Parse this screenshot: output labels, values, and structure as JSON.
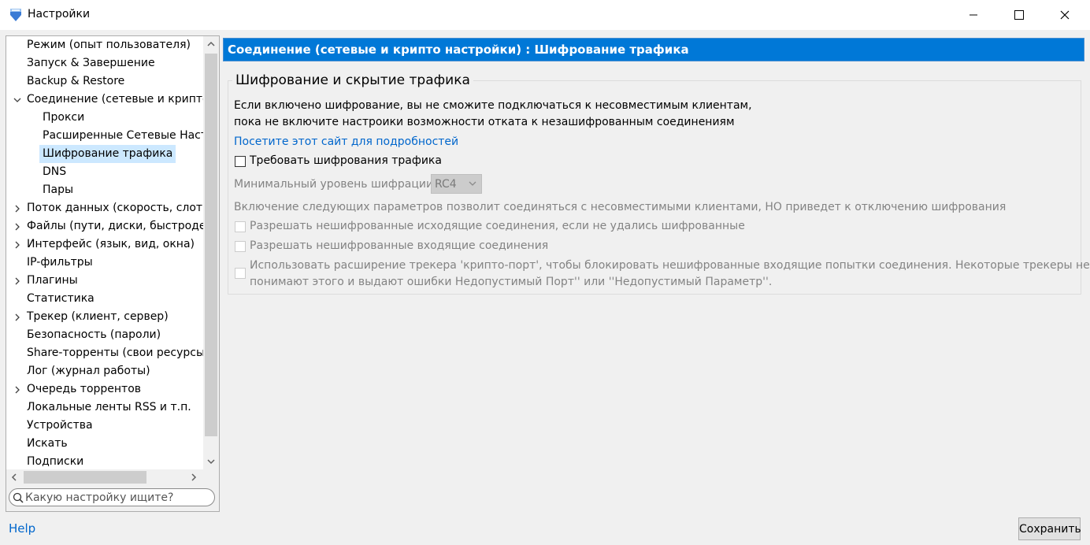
{
  "window": {
    "title": "Настройки"
  },
  "tree": {
    "items": [
      {
        "label": "Режим (опыт пользователя)",
        "level": 0,
        "expander": "none"
      },
      {
        "label": "Запуск & Завершение",
        "level": 0,
        "expander": "none"
      },
      {
        "label": "Backup & Restore",
        "level": 0,
        "expander": "none"
      },
      {
        "label": "Соединение (сетевые и крипто н",
        "level": 0,
        "expander": "expanded"
      },
      {
        "label": "Прокси",
        "level": 1,
        "expander": "none"
      },
      {
        "label": "Расширенные Сетевые Настр",
        "level": 1,
        "expander": "none"
      },
      {
        "label": "Шифрование трафика",
        "level": 1,
        "expander": "none",
        "selected": true
      },
      {
        "label": "DNS",
        "level": 1,
        "expander": "none"
      },
      {
        "label": "Пары",
        "level": 1,
        "expander": "none"
      },
      {
        "label": "Поток данных (скорость, слоты)",
        "level": 0,
        "expander": "collapsed"
      },
      {
        "label": "Файлы (пути, диски, быстродейс",
        "level": 0,
        "expander": "collapsed"
      },
      {
        "label": "Интерфейс (язык, вид, окна)",
        "level": 0,
        "expander": "collapsed"
      },
      {
        "label": "IP-фильтры",
        "level": 0,
        "expander": "none"
      },
      {
        "label": "Плагины",
        "level": 0,
        "expander": "collapsed"
      },
      {
        "label": "Статистика",
        "level": 0,
        "expander": "none"
      },
      {
        "label": "Трекер (клиент, сервер)",
        "level": 0,
        "expander": "collapsed"
      },
      {
        "label": "Безопасность (пароли)",
        "level": 0,
        "expander": "none"
      },
      {
        "label": "Share-торренты (свои ресурсы)",
        "level": 0,
        "expander": "none"
      },
      {
        "label": "Лог (журнал работы)",
        "level": 0,
        "expander": "none"
      },
      {
        "label": "Очередь торрентов",
        "level": 0,
        "expander": "collapsed"
      },
      {
        "label": "Локальные ленты RSS и т.п.",
        "level": 0,
        "expander": "none"
      },
      {
        "label": "Устройства",
        "level": 0,
        "expander": "none"
      },
      {
        "label": "Искать",
        "level": 0,
        "expander": "none"
      },
      {
        "label": "Подписки",
        "level": 0,
        "expander": "none"
      }
    ]
  },
  "search": {
    "placeholder": "Какую настройку ищите?"
  },
  "content": {
    "header": "Соединение (сетевые и крипто настройки) : Шифрование трафика",
    "group_title": "Шифрование и скрытие трафика",
    "desc_line1": "Если включено шифрование, вы не сможите подключаться к несовместимым клиентам,",
    "desc_line2": "пока не включите настроики возможности отката к незашифрованным соединениям",
    "link": "Посетите этот сайт для подробностей",
    "require_encryption": {
      "label": "Требовать шифрования трафика",
      "checked": false
    },
    "min_level_label": "Минимальный уровень шифрации",
    "min_level_value": "RC4",
    "fallback_note": "Включение следующих параметров позволит соединяться с несовместимыми клиентами, НО приведет к отключению шифрования",
    "allow_outgoing": {
      "label": "Разрешать нешифрованные исходящие соединения, если не удались шифрованные",
      "checked": false
    },
    "allow_incoming": {
      "label": "Разрешать нешифрованные входящие соединения",
      "checked": false
    },
    "crypto_port_line1": "Использовать расширение трекера 'крипто-порт', чтобы блокировать нешифрованные  входящие попытки соединения. Некоторые трекеры не",
    "crypto_port_line2": "понимают этого и выдают ошибки Недопустимый Порт'' или ''Недопустимый Параметр''."
  },
  "footer": {
    "help": "Help",
    "save": "Сохранить"
  },
  "colors": {
    "accent": "#0078d7",
    "selection": "#cce8ff",
    "link": "#0066cc",
    "disabled_text": "#838383"
  }
}
